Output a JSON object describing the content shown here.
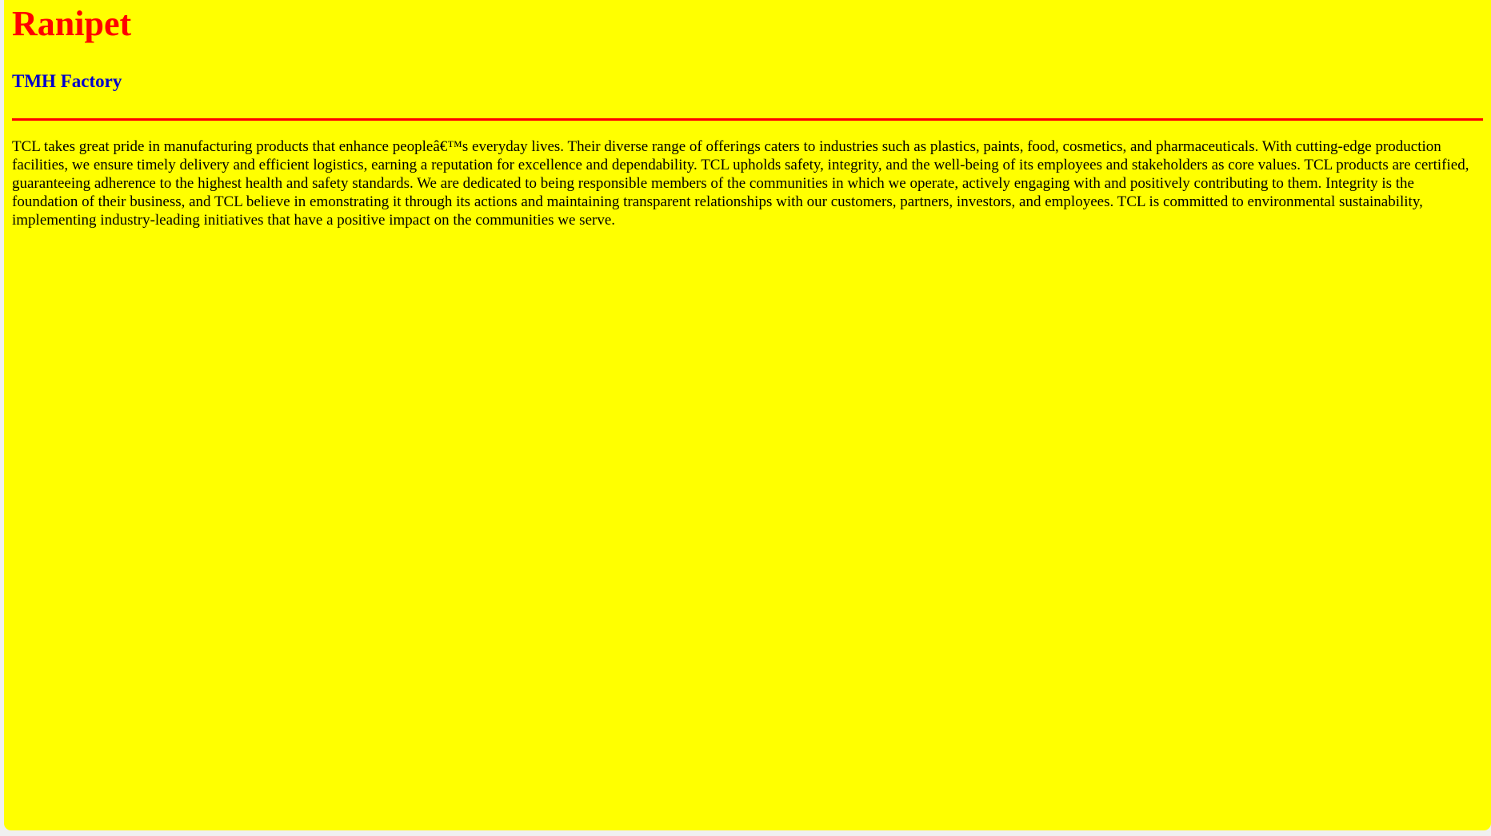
{
  "page": {
    "title": "Ranipet",
    "subtitle": "TMH Factory",
    "paragraph": "TCL takes great pride in manufacturing products that enhance peopleâ€™s everyday lives. Their diverse range of offerings caters to industries such as plastics, paints, food, cosmetics, and pharmaceuticals. With cutting-edge production facilities, we ensure timely delivery and efficient logistics, earning a reputation for excellence and dependability. TCL upholds safety, integrity, and the well-being of its employees and stakeholders as core values. TCL products are certified, guaranteeing adherence to the highest health and safety standards. We are dedicated to being responsible members of the communities in which we operate, actively engaging with and positively contributing to them. Integrity is the foundation of their business, and TCL believe in emonstrating it through its actions and maintaining transparent relationships with our customers, partners, investors, and employees. TCL is committed to environmental sustainability, implementing industry-leading initiatives that have a positive impact on the communities we serve."
  },
  "colors": {
    "background": "#ffff00",
    "title": "#ff0000",
    "subtitle": "#0000cc",
    "divider": "#ff0000",
    "text": "#000000"
  }
}
